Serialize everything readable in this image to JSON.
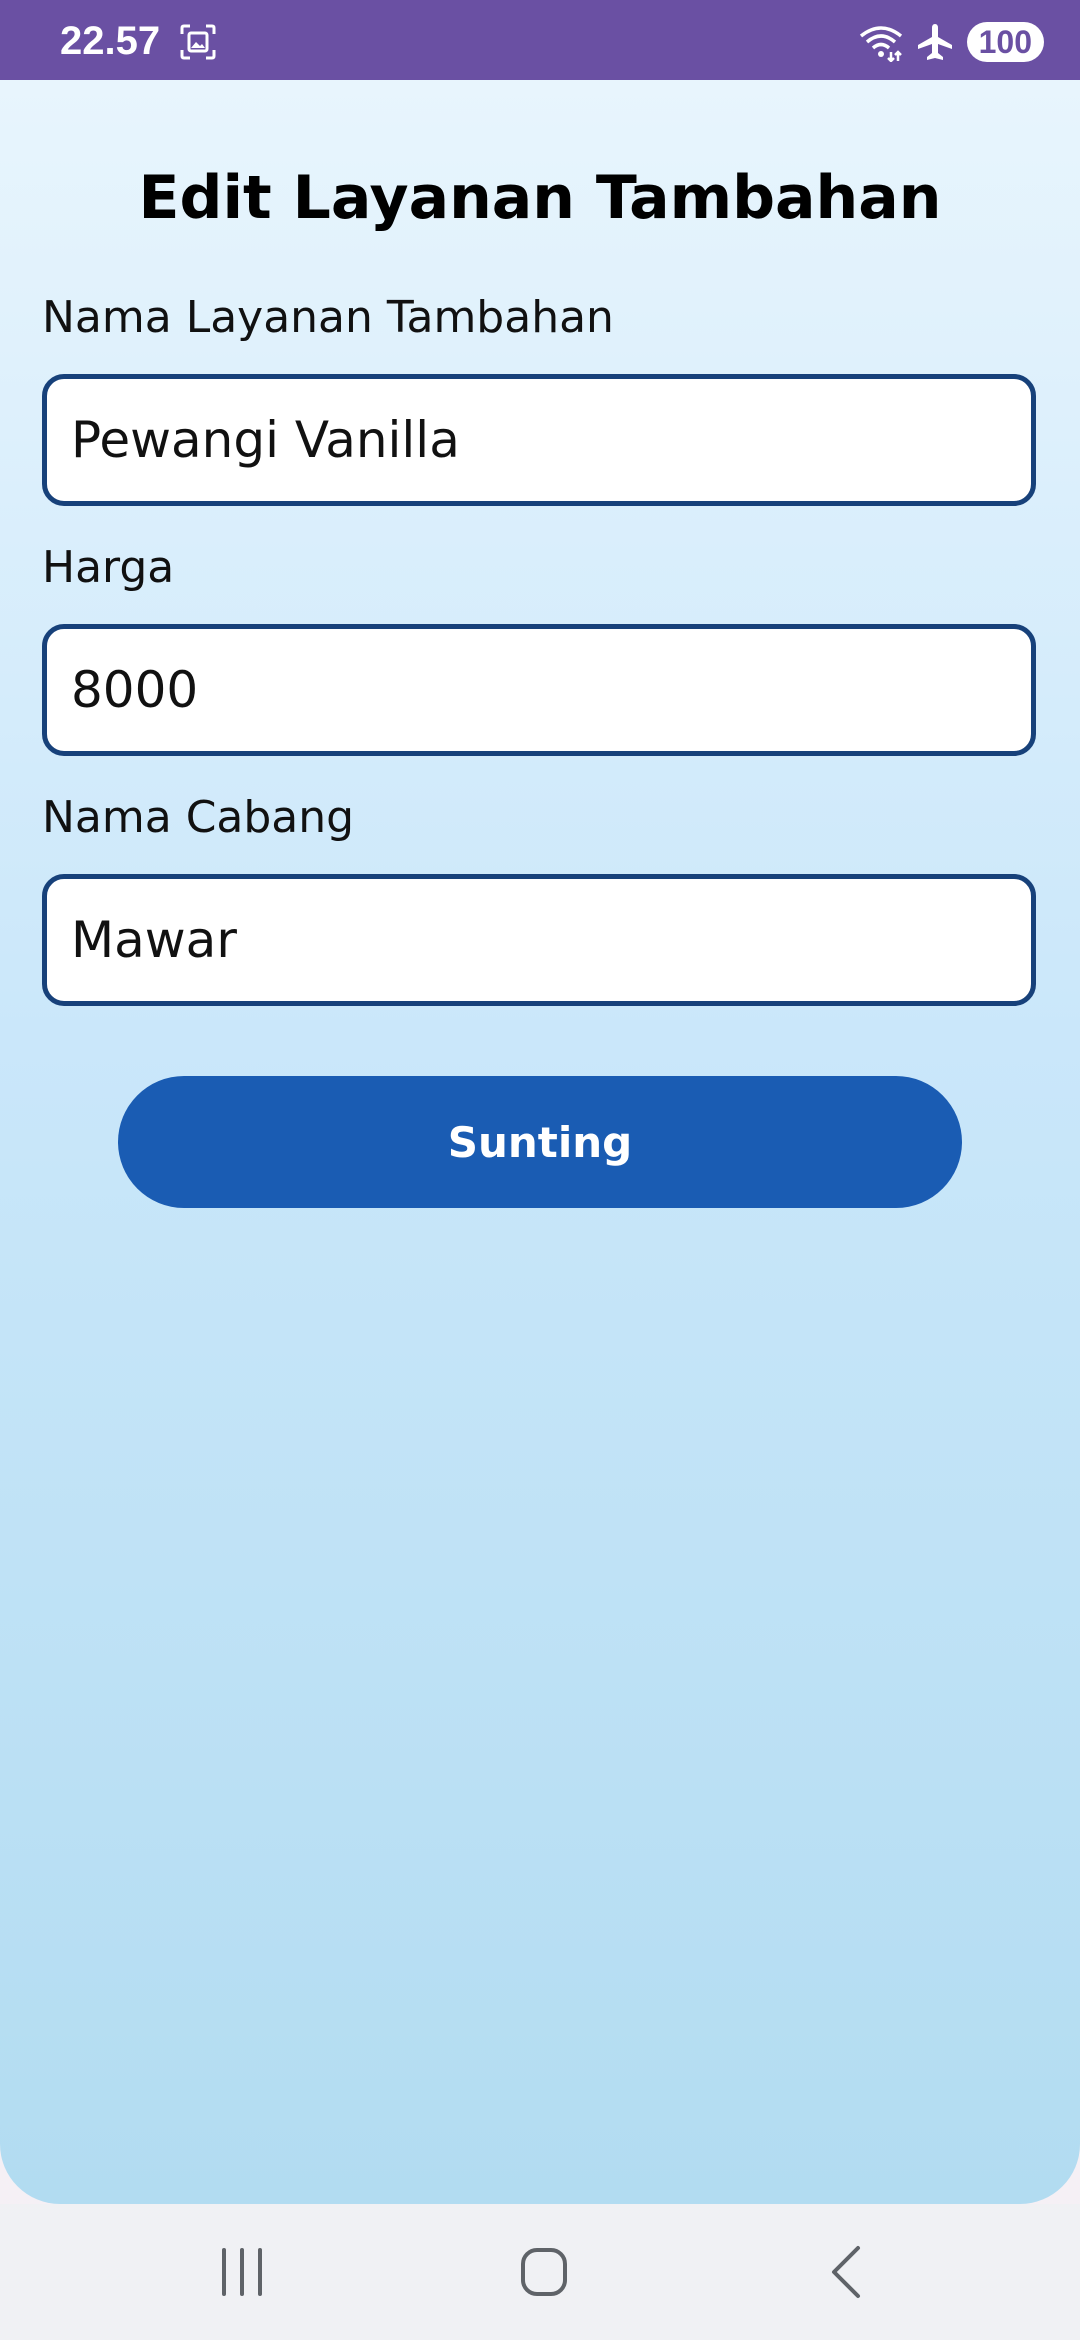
{
  "status_bar": {
    "time": "22.57",
    "battery": "100",
    "background_color": "#6a50a3",
    "icons": [
      "screenshot-icon",
      "wifi-icon",
      "airplane-icon"
    ]
  },
  "form": {
    "title": "Edit Layanan Tambahan",
    "fields": [
      {
        "label": "Nama Layanan Tambahan",
        "value": "Pewangi Vanilla"
      },
      {
        "label": "Harga",
        "value": "8000"
      },
      {
        "label": "Nama Cabang",
        "value": "Mawar"
      }
    ],
    "submit_label": "Sunting",
    "accent_color": "#1a5cb3",
    "field_border_color": "#17417a"
  },
  "nav_bar": {
    "icons": [
      "recent-apps-icon",
      "home-icon",
      "back-icon"
    ]
  }
}
